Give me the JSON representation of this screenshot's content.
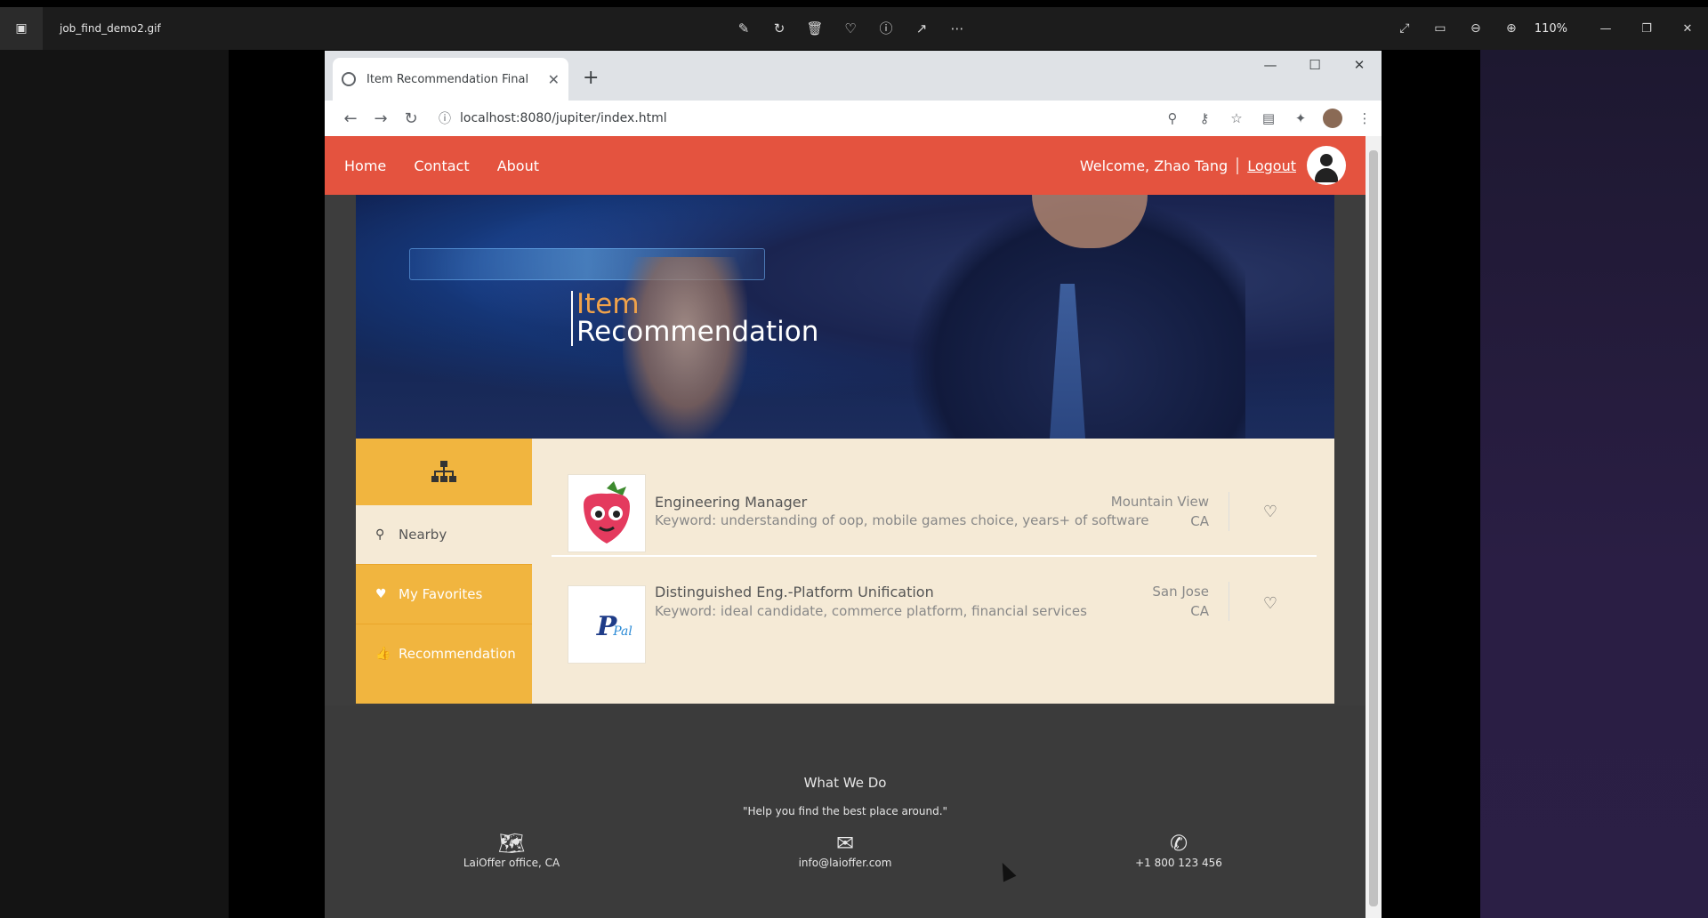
{
  "viewer": {
    "filename": "job_find_demo2.gif",
    "zoom": "110%"
  },
  "browser": {
    "tab_title": "Item Recommendation Final",
    "new_tab": "+",
    "url": "localhost:8080/jupiter/index.html"
  },
  "app": {
    "nav": [
      "Home",
      "Contact",
      "About"
    ],
    "welcome": "Welcome, Zhao Tang",
    "logout": "Logout"
  },
  "hero": {
    "title_line1": "Item",
    "title_line2": "Recommendation"
  },
  "sidebar": {
    "items": [
      {
        "label": "Nearby",
        "icon": "map-marker-icon"
      },
      {
        "label": "My Favorites",
        "icon": "heart-icon"
      },
      {
        "label": "Recommendation",
        "icon": "thumbs-up-icon"
      }
    ]
  },
  "items": [
    {
      "name": "Engineering Manager",
      "keyword": "Keyword: understanding of oop, mobile games choice, years+ of software",
      "city": "Mountain View",
      "state": "CA"
    },
    {
      "name": "Distinguished Eng.-Platform Unification",
      "keyword": "Keyword: ideal candidate, commerce platform, financial services",
      "city": "San Jose",
      "state": "CA"
    }
  ],
  "footer": {
    "title": "What We Do",
    "quote": "\"Help you find the best place around.\"",
    "address": "LaiOffer office, CA",
    "email": "info@laioffer.com",
    "phone": "+1 800 123 456"
  },
  "colors": {
    "header": "#e4533f",
    "sidebar": "#f1b53f",
    "content_bg": "#f5ead6",
    "hero_title_accent": "#f0a24a"
  }
}
